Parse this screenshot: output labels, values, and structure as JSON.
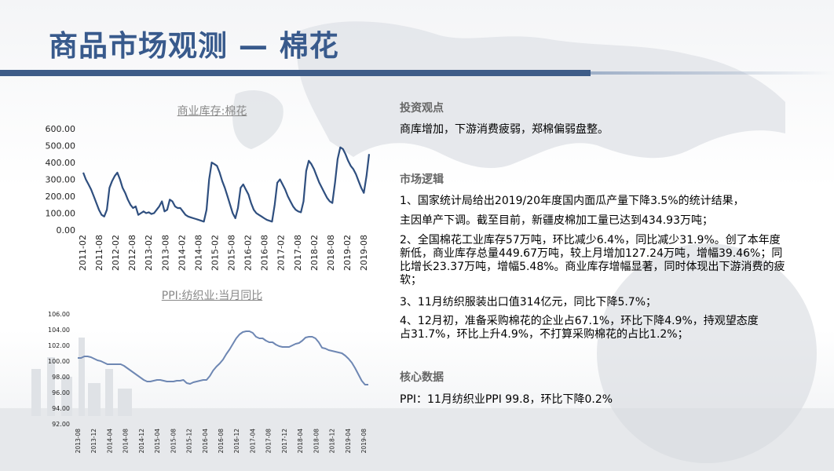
{
  "page": {
    "title": "商品市场观测 — 棉花"
  },
  "sections": {
    "view_heading": "投资观点",
    "view_text": "商库增加，下游消费疲弱，郑棉偏弱盘整。",
    "logic_heading": "市场逻辑",
    "logic_items": [
      "1、国家统计局给出2019/20年度国内面瓜产量下降3.5%的统计结果，",
      "主因单产下调。截至目前，新疆皮棉加工量已达到434.93万吨；",
      "2、全国棉花工业库存57万吨，环比减少6.4%，同比减少31.9%。创了本年度新低，商业库存总量449.67万吨，较上月增加127.24万吨，增幅39.46%；同比增长23.37万吨，增幅5.48%。商业库存增幅显著，同时体现出下游消费的疲软；",
      "3、11月纺织服装出口值314亿元，同比下降5.7%；",
      "4、12月初，准备采购棉花的企业占67.1%，环比下降4.9%，持观望态度占31.7%，环比上升4.9%，不打算采购棉花的占比1.2%；"
    ],
    "data_heading": "核心数据",
    "data_text": "PPI：11月纺织业PPI 99.8，环比下降0.2%"
  },
  "colors": {
    "title": "#385a8c",
    "bar": "#3e5c88",
    "line1": "#2f4f7f",
    "line2": "#6e87b3"
  },
  "chart_data": [
    {
      "type": "line",
      "title": "商业库存:棉花",
      "ylim": [
        0,
        600
      ],
      "yticks": [
        "600.00",
        "500.00",
        "400.00",
        "300.00",
        "200.00",
        "100.00",
        "0.00"
      ],
      "xticks": [
        "2011-02",
        "2011-08",
        "2012-02",
        "2012-08",
        "2013-02",
        "2013-08",
        "2014-02",
        "2014-08",
        "2015-02",
        "2015-08",
        "2016-02",
        "2016-08",
        "2017-02",
        "2017-08",
        "2018-02",
        "2018-08",
        "2019-02",
        "2019-08"
      ],
      "x_start": "2011-02",
      "series": [
        {
          "values": [
            340,
            300,
            270,
            240,
            200,
            160,
            120,
            90,
            80,
            120,
            250,
            290,
            320,
            340,
            300,
            250,
            220,
            180,
            150,
            130,
            140,
            90,
            100,
            110,
            100,
            105,
            95,
            100,
            120,
            140,
            170,
            110,
            120,
            180,
            170,
            140,
            130,
            130,
            110,
            90,
            80,
            75,
            70,
            65,
            60,
            55,
            50,
            120,
            300,
            400,
            390,
            380,
            340,
            290,
            250,
            200,
            150,
            100,
            70,
            130,
            250,
            270,
            240,
            210,
            160,
            120,
            100,
            90,
            80,
            70,
            60,
            55,
            50,
            150,
            280,
            300,
            270,
            240,
            200,
            170,
            140,
            120,
            110,
            105,
            170,
            350,
            410,
            390,
            360,
            320,
            280,
            250,
            220,
            190,
            170,
            160,
            280,
            420,
            490,
            480,
            450,
            410,
            380,
            360,
            330,
            290,
            250,
            220,
            320,
            450
          ]
        }
      ]
    },
    {
      "type": "line",
      "title": "PPI:纺织业:当月同比",
      "ylim": [
        92,
        106
      ],
      "yticks": [
        "106.00",
        "104.00",
        "102.00",
        "100.00",
        "98.00",
        "96.00",
        "94.00",
        "92.00"
      ],
      "xticks": [
        "2013-08",
        "2013-12",
        "2014-04",
        "2014-08",
        "2014-12",
        "2015-04",
        "2015-08",
        "2015-12",
        "2016-04",
        "2016-08",
        "2016-12",
        "2017-04",
        "2017-08",
        "2017-12",
        "2018-04",
        "2018-08",
        "2018-12",
        "2019-04",
        "2019-08"
      ],
      "x_start": "2013-08",
      "series": [
        {
          "values": [
            100.4,
            100.4,
            100.6,
            100.6,
            100.5,
            100.3,
            100.1,
            100.0,
            99.8,
            99.6,
            99.6,
            99.6,
            99.6,
            99.6,
            99.4,
            99.1,
            98.8,
            98.5,
            98.2,
            97.9,
            97.6,
            97.4,
            97.4,
            97.5,
            97.6,
            97.6,
            97.5,
            97.4,
            97.4,
            97.4,
            97.5,
            97.5,
            97.6,
            97.2,
            97.1,
            97.3,
            97.4,
            97.5,
            97.6,
            97.6,
            98.1,
            98.8,
            99.3,
            99.7,
            100.2,
            100.9,
            101.5,
            102.2,
            102.9,
            103.4,
            103.7,
            103.8,
            103.8,
            103.6,
            103.1,
            102.9,
            102.9,
            102.6,
            102.4,
            102.4,
            102.1,
            101.9,
            101.8,
            101.8,
            101.8,
            102.0,
            102.2,
            102.3,
            102.6,
            103.0,
            103.1,
            103.1,
            102.9,
            102.4,
            101.7,
            101.6,
            101.4,
            101.3,
            101.2,
            101.1,
            101.0,
            100.7,
            100.3,
            99.8,
            99.1,
            98.3,
            97.5,
            97.0,
            97.0
          ]
        }
      ]
    }
  ]
}
